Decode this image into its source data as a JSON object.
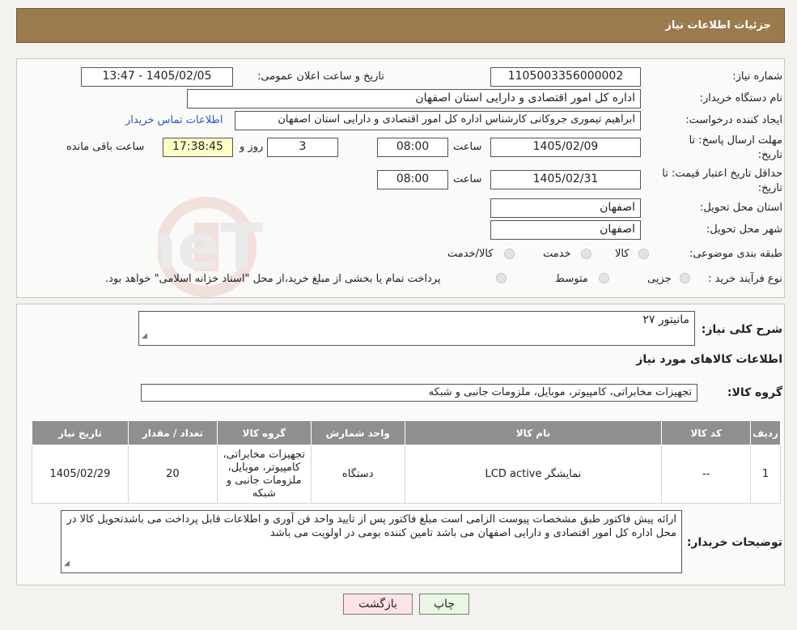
{
  "header": {
    "title": "جزئیات اطلاعات نیاز"
  },
  "form": {
    "need_number_label": "شماره نیاز:",
    "need_number": "1105003356000002",
    "announce_label": "تاریخ و ساعت اعلان عمومی:",
    "announce_value": "1405/02/05 - 13:47",
    "buyer_org_label": "نام دستگاه خریدار:",
    "buyer_org": "اداره کل امور اقتصادی و دارایی استان اصفهان",
    "creator_label": "ایجاد کننده درخواست:",
    "creator": "ابراهیم تیموری جروکانی کارشناس اداره کل امور اقتصادی و دارایی استان اصفهان",
    "contact_link": "اطلاعات تماس خریدار",
    "deadline_label_1": "مهلت ارسال پاسخ: تا",
    "deadline_label_2": "تاریخ:",
    "deadline_date": "1405/02/09",
    "time_label": "ساعت",
    "deadline_time": "08:00",
    "days_value": "3",
    "days_label": "روز و",
    "remaining_time": "17:38:45",
    "remaining_label": "ساعت باقی مانده",
    "validity_label_1": "حداقل تاریخ اعتبار قیمت: تا",
    "validity_label_2": "تاریخ:",
    "validity_date": "1405/02/31",
    "validity_time": "08:00",
    "province_label": "استان محل تحویل:",
    "province": "اصفهان",
    "city_label": "شهر محل تحویل:",
    "city": "اصفهان",
    "category_label": "طبقه بندی موضوعی:",
    "category_options": [
      "کالا",
      "خدمت",
      "کالا/خدمت"
    ],
    "process_label": "نوع فرآیند خرید :",
    "process_options": [
      "جزیی",
      "متوسط"
    ],
    "process_note": "پرداخت تمام یا بخشی از مبلغ خرید،از محل \"اسناد خزانه اسلامی\" خواهد بود."
  },
  "details": {
    "summary_label": "شرح کلی نیاز:",
    "summary": "مانیتور ۲۷",
    "items_title": "اطلاعات کالاهای مورد نیاز",
    "group_label": "گروه کالا:",
    "group": "تجهیزات مخابراتی، کامپیوتر، موبایل، ملزومات جانبی و شبکه",
    "table": {
      "headers": [
        "ردیف",
        "کد کالا",
        "نام کالا",
        "واحد شمارش",
        "گروه کالا",
        "تعداد / مقدار",
        "تاریخ نیاز"
      ],
      "rows": [
        {
          "row": "1",
          "code": "--",
          "name": "نمایشگر LCD active",
          "unit": "دستگاه",
          "group": "تجهیزات مخابراتی، کامپیوتر، موبایل، ملزومات جانبی و شبکه",
          "qty": "20",
          "date": "1405/02/29"
        }
      ]
    },
    "buyer_notes_label": "توضیحات خریدار:",
    "buyer_notes": "ارائه پیش فاکتور طبق مشخصات پیوست الزامی است مبلغ فاکتور پس از تایید واحد فن آوری و اطلاعات قابل پرداخت می باشدتحویل کالا در محل اداره کل امور اقتصادی و دارایی اصفهان می باشد  تامین کننده بومی در اولویت می باشد"
  },
  "buttons": {
    "print": "چاپ",
    "back": "بازگشت"
  },
  "colors": {
    "header_bg": "#9b7a4d",
    "back_bg": "#fde3e3",
    "print_bg": "#e8f7e3",
    "remaining_bg": "#ffffc8",
    "link": "#2a57c5"
  }
}
